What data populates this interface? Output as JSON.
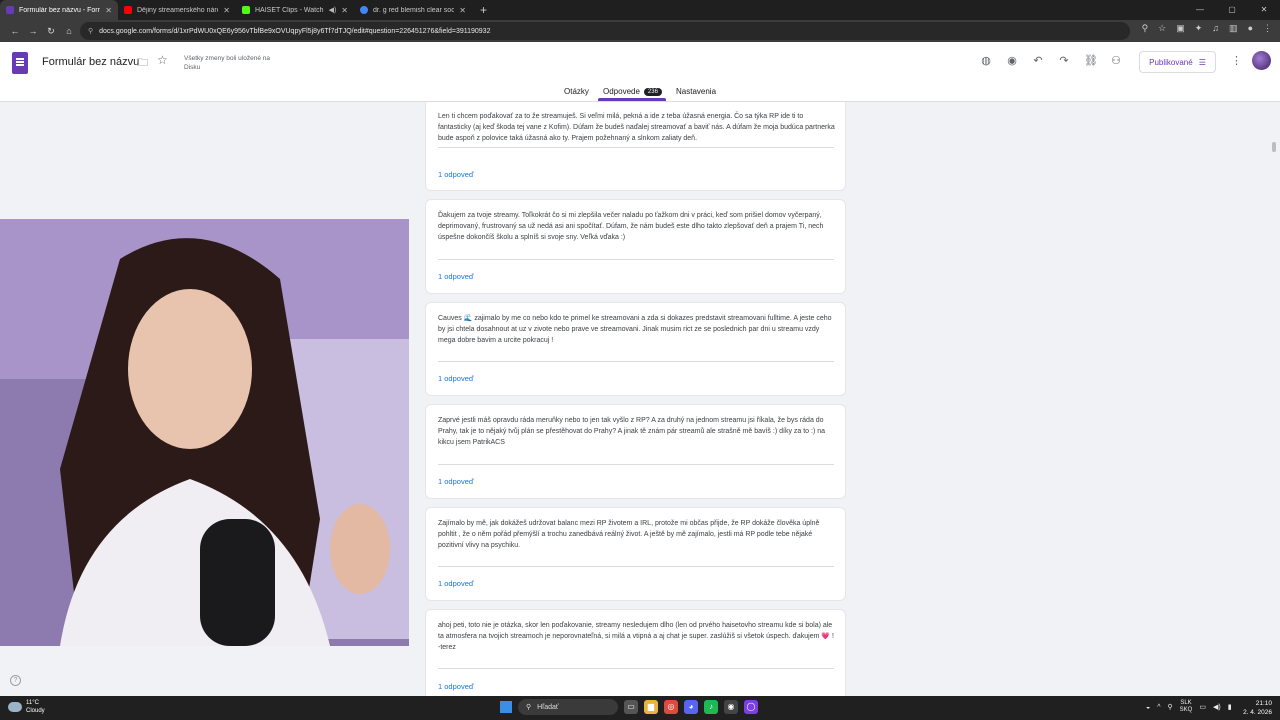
{
  "browser": {
    "tabs": [
      {
        "title": "Formulár bez názvu - Formulá",
        "active": true,
        "favicon_color": "#673ab7"
      },
      {
        "title": "Dějiny streamerského národa (",
        "active": false,
        "favicon_color": "#ff0000"
      },
      {
        "title": "HAISET Clips - Watch Live",
        "active": false,
        "favicon_color": "#53fc18"
      },
      {
        "title": "dr. g red blemish clear soothin",
        "active": false,
        "favicon_color": "#4285f4"
      }
    ],
    "new_tab_label": "+",
    "url": "docs.google.com/forms/d/1xrPdWU0xQE6y956vTbfBe9xOVUqpyFl5j8y6Tf7dTJQ/edit#question=226451276&field=391190932"
  },
  "form_header": {
    "title": "Formulár bez názvu",
    "saved_status": "Všetky zmeny boli uložené na Disku",
    "publish_label": "Publikované",
    "tabs": [
      {
        "label": "Otázky"
      },
      {
        "label": "Odpovede",
        "badge": "236"
      },
      {
        "label": "Nastavenia"
      }
    ]
  },
  "responses": [
    {
      "text": "Len ti chcem poďakovať za to že streamuješ. Si veľmi milá, pekná a ide z teba úžasná energia. Čo sa týka RP ide ti to fantasticky (aj keď škoda tej vane z Kofim). Dúfam že budeš naďalej streamovať a baviť nás. A dúfam že moja budúca partnerka bude aspoň z polovice taká úžasná ako ty. Prajem požehnaný a slnkom zaliaty deň.",
      "reply": "1 odpoveď"
    },
    {
      "text": "Ďakujem za tvoje streamy. Toľkokrát čo si mi zlepšila večer naladu po ťažkom dni v práci, keď som prišiel domov vyčerpaný, deprimovaný, frustrovaný sa už nedá asi ani spočítať. Dúfam, že nám budeš este dlho takto zlepšovať deň a prajem Ti, nech úspešne dokončíš školu a splníš si svoje sny. Veľká vďaka :)",
      "reply": "1 odpoveď"
    },
    {
      "text": "Cauves 🌊 zajimalo by me co nebo kdo te primel ke streamovani a zda si dokazes predstavit streamovani fulltime. A jeste ceho by jsi chtela dosahnout at uz v zivote nebo prave ve streamovani. Jinak musim rict ze se poslednich par dni u streamu vzdy mega dobre bavim a urcite pokracuj !",
      "reply": "1 odpoveď"
    },
    {
      "text": "Zaprvé jestli máš opravdu ráda meruňky nebo to jen tak vyšlo z RP? A za druhý na jednom streamu jsi říkala, že bys ráda do Prahy, tak je to nějaký tvůj plán se přestěhovat do Prahy? A jinak tě znám pár streamů ale strašně mě bavíš :) díky za to :) na kikcu jsem PatrikACS",
      "reply": "1 odpoveď"
    },
    {
      "text": "Zajímalo by mě, jak dokážeš udržovat balanc mezi RP životem a IRL, protože mi občas přijde, že RP dokáže člověka úplně pohltit , že o něm pořád přemýšlí a trochu zanedbává reálný život. A ještě by mě zajímalo, jestli má RP podle tebe nějaké pozitivní vlivy na psychiku.",
      "reply": "1 odpoveď"
    },
    {
      "text": "ahoj peti, toto nie je otázka, skor len poďakovanie, streamy nesledujem dlho (len od prvého haisetovho streamu kde si bola) ale ta atmosfera na tvojich streamoch je neporovnateľná, si milá a vtipná a aj chat je super. zaslúžiš si všetok úspech. ďakujem 💗 ! -terez",
      "reply": "1 odpoveď"
    }
  ],
  "taskbar": {
    "weather_temp": "11°C",
    "weather_desc": "Cloudy",
    "search_label": "Hľadať",
    "lang_top": "SLK",
    "lang_bottom": "SKQ",
    "time": "21:10",
    "date": "2. 4. 2026"
  }
}
